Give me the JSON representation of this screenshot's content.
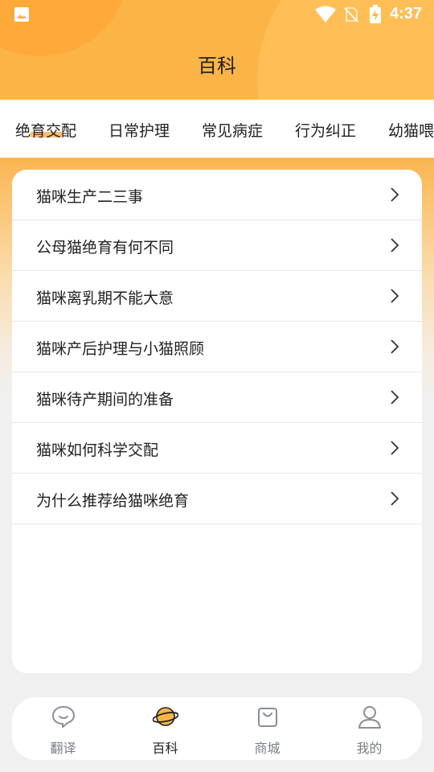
{
  "status_bar": {
    "time": "4:37",
    "icons": [
      "image-icon",
      "wifi-icon",
      "no-sim-icon",
      "battery-charging-icon"
    ]
  },
  "header": {
    "title": "百科"
  },
  "tabs": [
    {
      "label": "绝育交配",
      "active": true
    },
    {
      "label": "日常护理",
      "active": false
    },
    {
      "label": "常见病症",
      "active": false
    },
    {
      "label": "行为纠正",
      "active": false
    },
    {
      "label": "幼猫喂",
      "active": false
    }
  ],
  "articles": [
    {
      "title": "猫咪生产二三事"
    },
    {
      "title": "公母猫绝育有何不同"
    },
    {
      "title": "猫咪离乳期不能大意"
    },
    {
      "title": "猫咪产后护理与小猫照顾"
    },
    {
      "title": "猫咪待产期间的准备"
    },
    {
      "title": "猫咪如何科学交配"
    },
    {
      "title": "为什么推荐给猫咪绝育"
    }
  ],
  "bottom_nav": [
    {
      "label": "翻译",
      "icon": "chat-bubble-icon",
      "active": false
    },
    {
      "label": "百科",
      "icon": "planet-icon",
      "active": true
    },
    {
      "label": "商城",
      "icon": "shopping-bag-icon",
      "active": false
    },
    {
      "label": "我的",
      "icon": "user-icon",
      "active": false
    }
  ],
  "colors": {
    "accent": "#fdb446",
    "accent_dark": "#f5a020",
    "nav_inactive": "#7a7e8a"
  }
}
